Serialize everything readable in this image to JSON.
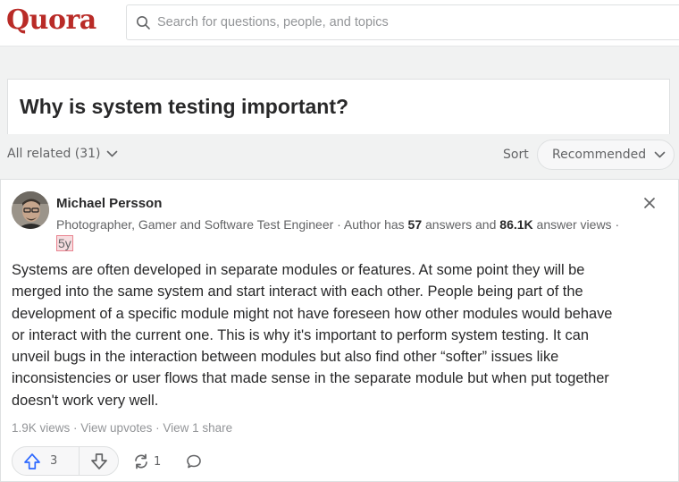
{
  "header": {
    "logo": "Quora",
    "search_placeholder": "Search for questions, people, and topics"
  },
  "question": {
    "title": "Why is system testing important?"
  },
  "filters": {
    "all_related": "All related (31)",
    "sort_label": "Sort",
    "sort_value": "Recommended"
  },
  "answer": {
    "author": "Michael Persson",
    "credential_prefix": "Photographer, Gamer and Software Test Engineer · Author has ",
    "answers_count": "57",
    "credential_mid": " answers and ",
    "answer_views": "86.1K",
    "credential_suffix": " answer views ·",
    "date": "5y",
    "body_lines": [
      "Systems are often developed in separate modules or features. At some point they will be",
      "merged into the same system and start interact with each other. People being part of the",
      "development of a specific module might not have foreseen how other modules would behave",
      "or interact with the current one. This is why it's important to perform system testing. It can",
      "unveil bugs in the interaction between modules but also find other “softer” issues like",
      "inconsistencies or user flows that made sense in the separate module but when put together",
      "doesn't work very well."
    ],
    "views": "1.9K views",
    "view_upvotes": "View upvotes",
    "view_shares": "View 1 share",
    "upvotes": "3",
    "shares": "1"
  },
  "colors": {
    "brand": "#b92b27",
    "upvote_blue": "#2e69ff",
    "page_bg": "#f1f2f2"
  },
  "icons": [
    "search-icon",
    "chevron-down-icon",
    "close-icon",
    "upvote-icon",
    "downvote-icon",
    "share-icon",
    "comment-icon"
  ]
}
